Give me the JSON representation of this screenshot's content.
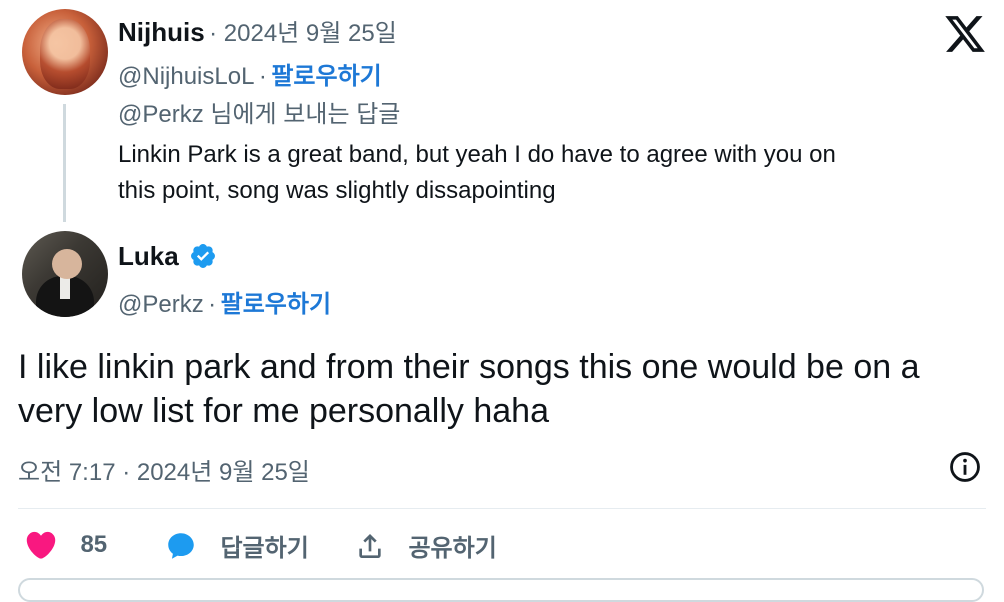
{
  "reply": {
    "name": "Nijhuis",
    "date": "· 2024년 9월 25일",
    "handle": "@NijhuisLoL",
    "sep": "·",
    "follow": "팔로우하기",
    "replying_to": "@Perkz 님에게 보내는 답글",
    "text_line1": "Linkin Park is a great band, but yeah I do have to agree with you on",
    "text_line2": "this point, song was slightly dissapointing"
  },
  "main": {
    "name": "Luka",
    "handle": "@Perkz",
    "sep": "·",
    "follow": "팔로우하기",
    "text_line1": "I like linkin park and from their songs this one would be on a",
    "text_line2": "very low list for me personally haha",
    "timestamp": "오전 7:17 · 2024년 9월 25일"
  },
  "actions": {
    "likes": "85",
    "reply_label": "답글하기",
    "share_label": "공유하기"
  },
  "colors": {
    "link": "#1d78d6",
    "like": "#f91880",
    "reply_icon": "#1d9bf0",
    "verified": "#1d9bf0"
  },
  "icons": [
    "x-logo-icon",
    "verified-badge-icon",
    "info-icon",
    "heart-icon",
    "speech-bubble-icon",
    "share-icon"
  ]
}
